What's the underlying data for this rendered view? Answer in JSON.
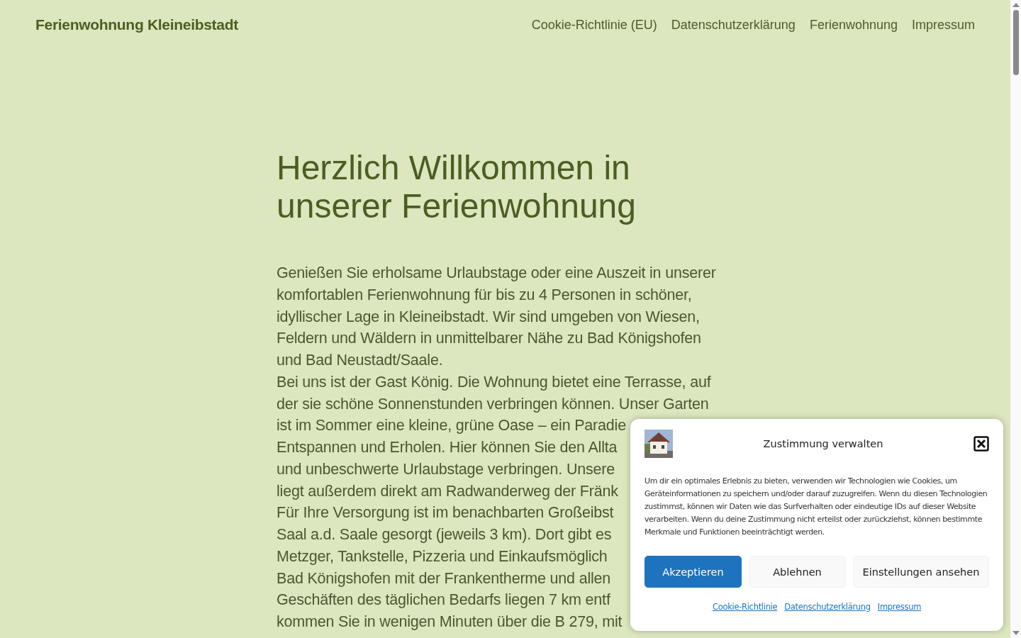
{
  "header": {
    "site_title": "Ferienwohnung Kleineibstadt",
    "nav": [
      "Cookie-Richtlinie (EU)",
      "Datenschutzerklärung",
      "Ferienwohnung",
      "Impressum"
    ]
  },
  "main": {
    "heading_lines": [
      "Herzlich Willkommen in",
      "unserer Ferienwohnung"
    ],
    "lines": [
      "Genießen Sie erholsame Urlaubstage oder eine Auszeit in unserer",
      "komfortablen Ferienwohnung für bis zu 4 Personen in schöner,",
      "idyllischer Lage in Kleineibstadt. Wir sind umgeben von Wiesen,",
      "Feldern und Wäldern in unmittelbarer Nähe zu Bad Königshofen",
      "und Bad Neustadt/Saale.",
      "Bei uns ist der Gast König. Die Wohnung bietet eine Terrasse, auf",
      "der sie schöne Sonnenstunden verbringen können. Unser Garten",
      "ist im Sommer eine kleine, grüne Oase – ein Paradie",
      "Entspannen und Erholen. Hier können Sie den Allta",
      "und unbeschwerte Urlaubstage verbringen. Unsere",
      "liegt außerdem direkt am Radwanderweg der Fränk",
      "Für Ihre Versorgung ist im benachbarten Großeibst",
      "Saal a.d. Saale gesorgt (jeweils 3 km). Dort gibt es",
      "Metzger, Tankstelle, Pizzeria und Einkaufsmöglich",
      "Bad Königshofen mit der Frankentherme und allen",
      "Geschäften des täglichen Bedarfs liegen 7 km entf",
      "kommen Sie in wenigen Minuten über die B 279, mit"
    ]
  },
  "consent_dialog": {
    "title": "Zustimmung verwalten",
    "text": "Um dir ein optimales Erlebnis zu bieten, verwenden wir Technologien wie Cookies, um Geräteinformationen zu speichern und/oder darauf zuzugreifen. Wenn du diesen Technologien zustimmst, können wir Daten wie das Surfverhalten oder eindeutige IDs auf dieser Website verarbeiten. Wenn du deine Zustimmung nicht erteilst oder zurückziehst, können bestimmte Merkmale und Funktionen beeinträchtigt werden.",
    "buttons": [
      {
        "label": "Akzeptieren",
        "kind": "primary"
      },
      {
        "label": "Ablehnen",
        "kind": "secondary"
      },
      {
        "label": "Einstellungen ansehen",
        "kind": "secondary"
      }
    ],
    "links": [
      "Cookie-Richtlinie",
      "Datenschutzerklärung",
      "Impressum"
    ]
  }
}
